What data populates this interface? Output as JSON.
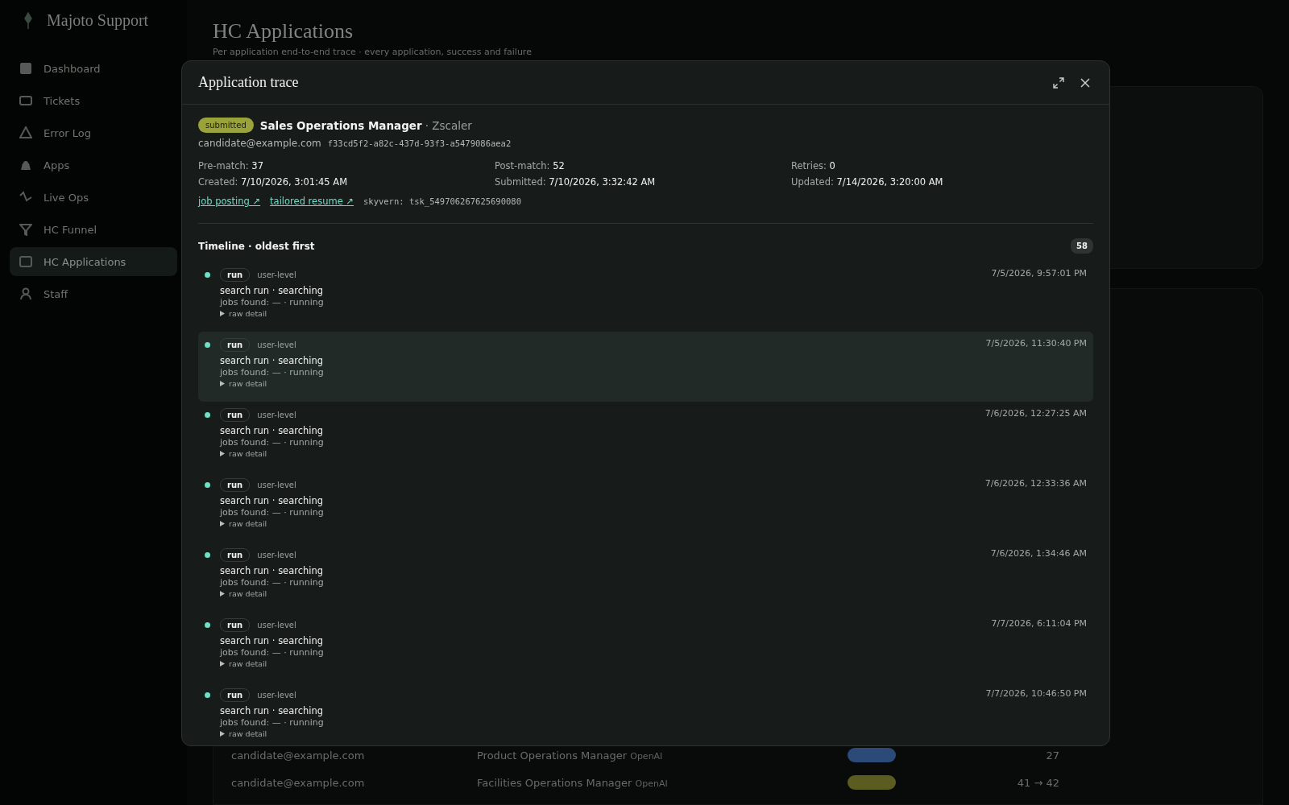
{
  "sidebar": {
    "brand": "Majoto Support",
    "items": [
      {
        "label": "Dashboard",
        "selected": false
      },
      {
        "label": "Tickets",
        "selected": false
      },
      {
        "label": "Error Log",
        "selected": false
      },
      {
        "label": "Apps",
        "selected": false
      },
      {
        "label": "Live Ops",
        "selected": false
      },
      {
        "label": "HC Funnel",
        "selected": false
      },
      {
        "label": "HC Applications",
        "selected": true
      },
      {
        "label": "Staff",
        "selected": false
      }
    ]
  },
  "page": {
    "title": "HC Applications",
    "subtitle": "Per application end-to-end trace · every application, success and failure"
  },
  "table": {
    "rows": [
      {
        "email": "candidate@example.com",
        "role": "Product Operations Manager",
        "company": "OpenAI",
        "color": "#2c4a78",
        "score": "27"
      },
      {
        "email": "candidate@example.com",
        "role": "Facilities Operations Manager",
        "company": "OpenAI",
        "color": "#5a5c20",
        "score": "41 → 42"
      }
    ]
  },
  "modal": {
    "title": "Application trace",
    "application": {
      "status": "submitted",
      "role": "Sales Operations Manager",
      "company": "· Zscaler",
      "email": "candidate@example.com",
      "id": "f33cd5f2-a82c-437d-93f3-a5479086aea2",
      "meta": [
        {
          "label": "Pre-match:",
          "value": "37"
        },
        {
          "label": "Post-match:",
          "value": "52"
        },
        {
          "label": "Retries:",
          "value": "0"
        },
        {
          "label": "Created:",
          "value": "7/10/2026, 3:01:45 AM"
        },
        {
          "label": "Submitted:",
          "value": "7/10/2026, 3:32:42 AM"
        },
        {
          "label": "Updated:",
          "value": "7/14/2026, 3:20:00 AM"
        }
      ],
      "links": [
        "job posting ↗",
        "tailored resume ↗"
      ],
      "skyvern": "skyvern: tsk_549706267625690080"
    },
    "timeline": {
      "title": "Timeline · oldest first",
      "count": "58",
      "events": [
        {
          "tag": "run",
          "level": "user-level",
          "title": "search run · searching",
          "detail": "jobs found: — · running",
          "toggle": "raw detail",
          "time": "7/5/2026, 9:57:01 PM",
          "hovered": false
        },
        {
          "tag": "run",
          "level": "user-level",
          "title": "search run · searching",
          "detail": "jobs found: — · running",
          "toggle": "raw detail",
          "time": "7/5/2026, 11:30:40 PM",
          "hovered": true
        },
        {
          "tag": "run",
          "level": "user-level",
          "title": "search run · searching",
          "detail": "jobs found: — · running",
          "toggle": "raw detail",
          "time": "7/6/2026, 12:27:25 AM",
          "hovered": false
        },
        {
          "tag": "run",
          "level": "user-level",
          "title": "search run · searching",
          "detail": "jobs found: — · running",
          "toggle": "raw detail",
          "time": "7/6/2026, 12:33:36 AM",
          "hovered": false
        },
        {
          "tag": "run",
          "level": "user-level",
          "title": "search run · searching",
          "detail": "jobs found: — · running",
          "toggle": "raw detail",
          "time": "7/6/2026, 1:34:46 AM",
          "hovered": false
        },
        {
          "tag": "run",
          "level": "user-level",
          "title": "search run · searching",
          "detail": "jobs found: — · running",
          "toggle": "raw detail",
          "time": "7/7/2026, 6:11:04 PM",
          "hovered": false
        },
        {
          "tag": "run",
          "level": "user-level",
          "title": "search run · searching",
          "detail": "jobs found: — · running",
          "toggle": "raw detail",
          "time": "7/7/2026, 10:46:50 PM",
          "hovered": false
        }
      ]
    }
  }
}
